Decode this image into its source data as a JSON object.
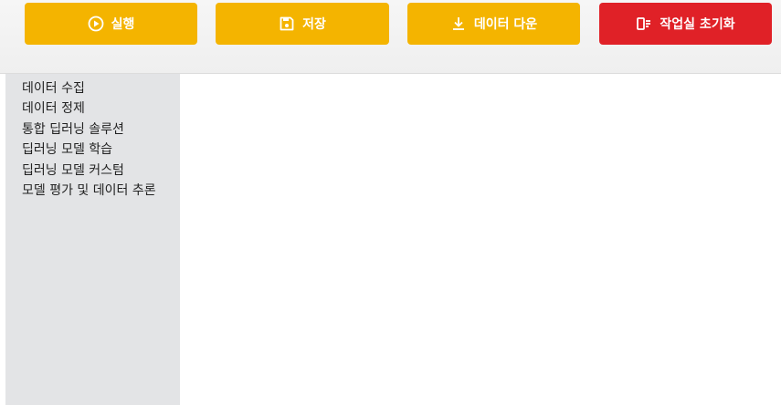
{
  "toolbar": {
    "run_label": "실행",
    "save_label": "저장",
    "download_label": "데이터 다운",
    "reset_label": "작업실 초기화",
    "colors": {
      "primary": "#f4b400",
      "danger": "#e02127"
    },
    "icons": {
      "run": "play-circle-icon",
      "save": "floppy-disk-icon",
      "download": "download-icon",
      "reset": "reset-workspace-icon"
    }
  },
  "sidebar": {
    "items": [
      {
        "label": "데이터 수집"
      },
      {
        "label": "데이터 정제"
      },
      {
        "label": "통합 딥러닝 솔루션"
      },
      {
        "label": "딥러닝 모델 학습"
      },
      {
        "label": "딥러닝 모델 커스텀"
      },
      {
        "label": "모델 평가 및 데이터 추론"
      }
    ]
  }
}
